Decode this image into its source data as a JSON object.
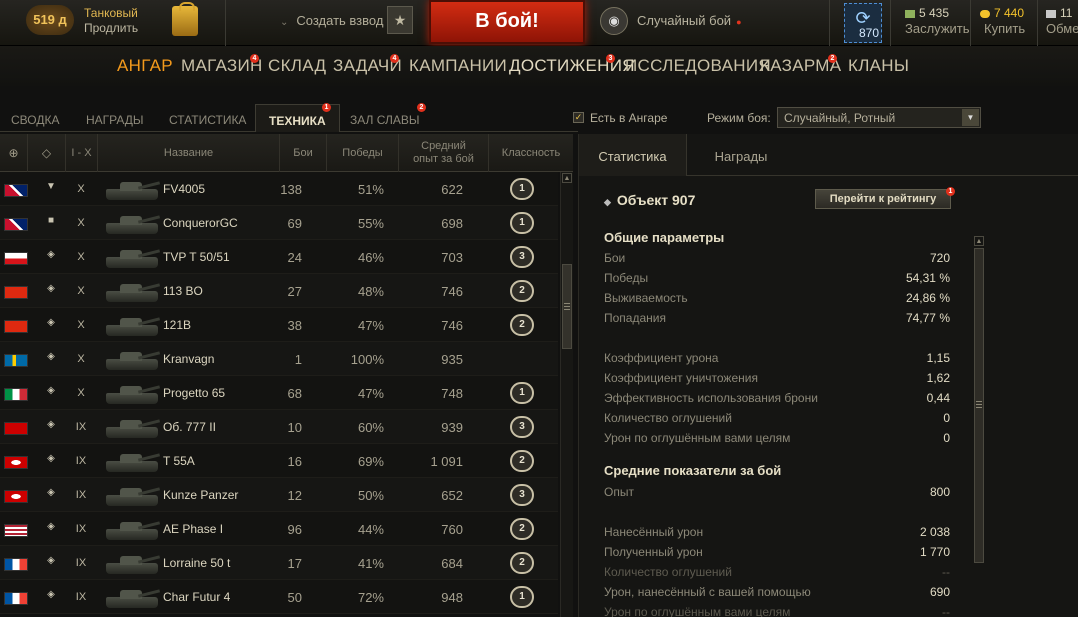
{
  "topbar": {
    "premium_days": "519 д",
    "premium_title": "Танковый",
    "premium_action": "Продлить",
    "platoon_label": "Создать взвод",
    "battle_button": "В бой!",
    "battle_mode": "Случайный бой",
    "free_xp": "870",
    "currencies": [
      {
        "value": "5 435",
        "label": "Заслужить",
        "icon": "bonds-icon",
        "color": "#8fb15c"
      },
      {
        "value": "7 440",
        "label": "Купить",
        "icon": "gold-icon",
        "color": "#f3c22b"
      },
      {
        "value": "11",
        "label": "Обме",
        "icon": "credits-icon",
        "color": "#c8c8c8"
      }
    ]
  },
  "nav": {
    "items": [
      {
        "label": "АНГАР",
        "active": true,
        "badge": ""
      },
      {
        "label": "МАГАЗИН",
        "badge": "4"
      },
      {
        "label": "СКЛАД",
        "badge": ""
      },
      {
        "label": "ЗАДАЧИ",
        "badge": "4"
      },
      {
        "label": "КАМПАНИИ",
        "badge": ""
      },
      {
        "label": "ДОСТИЖЕНИЯ",
        "badge": "3"
      },
      {
        "label": "ИССЛЕДОВАНИЯ",
        "badge": ""
      },
      {
        "label": "КАЗАРМА",
        "badge": "2"
      },
      {
        "label": "КЛАНЫ",
        "badge": ""
      }
    ]
  },
  "subtabs": {
    "items": [
      {
        "label": "СВОДКА"
      },
      {
        "label": "НАГРАДЫ"
      },
      {
        "label": "СТАТИСТИКА"
      },
      {
        "label": "ТЕХНИКА",
        "active": true,
        "badge": "1"
      },
      {
        "label": "ЗАЛ СЛАВЫ",
        "badge": "2"
      }
    ],
    "in_hangar_label": "Есть в Ангаре",
    "in_hangar_checked": true,
    "battle_mode_label": "Режим боя:",
    "battle_mode_value": "Случайный, Ротный"
  },
  "table": {
    "columns": {
      "nation": "globe-icon",
      "type": "vehicle-type-icon",
      "tier": "I - X",
      "name": "Название",
      "battles": "Бои",
      "wins": "Победы",
      "avg_xp_1": "Средний",
      "avg_xp_2": "опыт за бой",
      "mastery": "Классность"
    },
    "rows": [
      {
        "nation": "uk",
        "type": "▼",
        "tier": "X",
        "name": "FV4005",
        "battles": "138",
        "wins": "51%",
        "xp": "622",
        "mastery": "1"
      },
      {
        "nation": "uk",
        "type": "■",
        "tier": "X",
        "name": "ConquerorGC",
        "battles": "69",
        "wins": "55%",
        "xp": "698",
        "mastery": "1"
      },
      {
        "nation": "czech",
        "type": "◈",
        "tier": "X",
        "name": "TVP T 50/51",
        "battles": "24",
        "wins": "46%",
        "xp": "703",
        "mastery": "3"
      },
      {
        "nation": "china",
        "type": "◈",
        "tier": "X",
        "name": "113 BO",
        "battles": "27",
        "wins": "48%",
        "xp": "746",
        "mastery": "2"
      },
      {
        "nation": "china",
        "type": "◈",
        "tier": "X",
        "name": "121B",
        "battles": "38",
        "wins": "47%",
        "xp": "746",
        "mastery": "2"
      },
      {
        "nation": "sweden",
        "type": "◈",
        "tier": "X",
        "name": "Kranvagn",
        "battles": "1",
        "wins": "100%",
        "xp": "935",
        "mastery": ""
      },
      {
        "nation": "italy",
        "type": "◈",
        "tier": "X",
        "name": "Progetto 65",
        "battles": "68",
        "wins": "47%",
        "xp": "748",
        "mastery": "1"
      },
      {
        "nation": "ussr",
        "type": "◈",
        "tier": "IX",
        "name": "Об. 777 II",
        "battles": "10",
        "wins": "60%",
        "xp": "939",
        "mastery": "3"
      },
      {
        "nation": "germany",
        "type": "◈",
        "tier": "IX",
        "name": "T 55A",
        "battles": "16",
        "wins": "69%",
        "xp": "1 091",
        "mastery": "2"
      },
      {
        "nation": "germany",
        "type": "◈",
        "tier": "IX",
        "name": "Kunze Panzer",
        "battles": "12",
        "wins": "50%",
        "xp": "652",
        "mastery": "3"
      },
      {
        "nation": "usa",
        "type": "◈",
        "tier": "IX",
        "name": "AE Phase I",
        "battles": "96",
        "wins": "44%",
        "xp": "760",
        "mastery": "2"
      },
      {
        "nation": "france",
        "type": "◈",
        "tier": "IX",
        "name": "Lorraine 50 t",
        "battles": "17",
        "wins": "41%",
        "xp": "684",
        "mastery": "2"
      },
      {
        "nation": "france",
        "type": "◈",
        "tier": "IX",
        "name": "Char Futur 4",
        "battles": "50",
        "wins": "72%",
        "xp": "948",
        "mastery": "1"
      }
    ]
  },
  "panel": {
    "tabs": [
      "Статистика",
      "Награды"
    ],
    "vehicle_name": "Объект 907",
    "rating_button": "Перейти к рейтингу",
    "rating_badge": "1",
    "general_title": "Общие параметры",
    "general": [
      {
        "k": "Бои",
        "v": "720"
      },
      {
        "k": "Победы",
        "v": "54,31 %"
      },
      {
        "k": "Выживаемость",
        "v": "24,86 %"
      },
      {
        "k": "Попадания",
        "v": "74,77 %"
      },
      {
        "k": "",
        "v": ""
      },
      {
        "k": "Коэффициент урона",
        "v": "1,15"
      },
      {
        "k": "Коэффициент уничтожения",
        "v": "1,62"
      },
      {
        "k": "Эффективность использования брони",
        "v": "0,44"
      },
      {
        "k": "Количество оглушений",
        "v": "0"
      },
      {
        "k": "Урон по оглушённым вами целям",
        "v": "0"
      }
    ],
    "avg_title": "Средние показатели за бой",
    "avg": [
      {
        "k": "Опыт",
        "v": "800"
      },
      {
        "k": "",
        "v": ""
      },
      {
        "k": "Нанесённый урон",
        "v": "2 038"
      },
      {
        "k": "Полученный урон",
        "v": "1 770"
      },
      {
        "k": "Количество оглушений",
        "v": "--",
        "dim": true
      },
      {
        "k": "Урон, нанесённый с вашей помощью",
        "v": "690"
      },
      {
        "k": "Урон по оглушённым вами целям",
        "v": "--",
        "dim": true
      }
    ]
  },
  "colors": {
    "accent": "#f39a1c",
    "battle_button": "#c42410",
    "badge": "#e0301c"
  }
}
